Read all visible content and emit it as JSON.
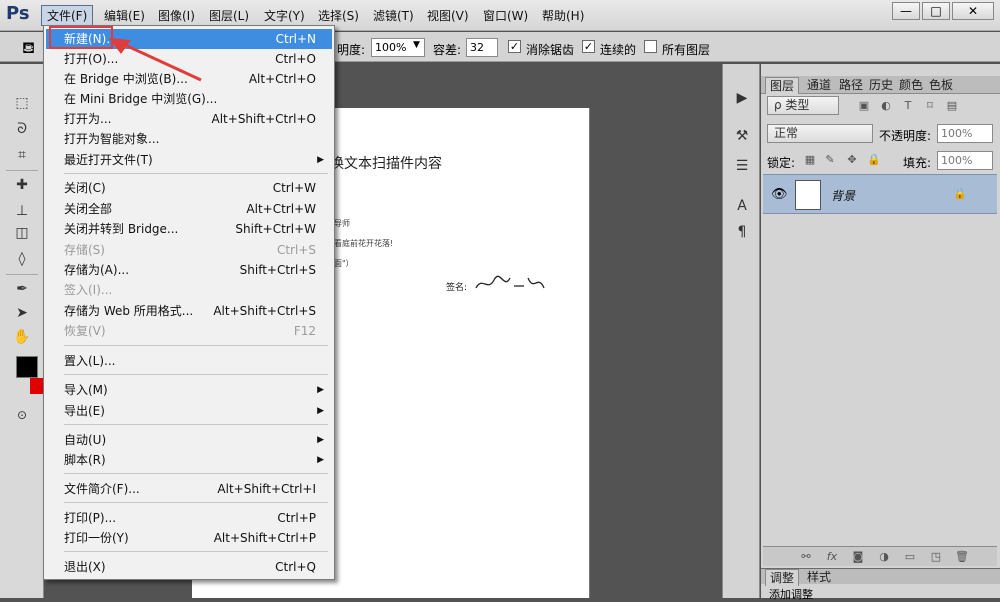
{
  "app": {
    "logo": "Ps",
    "menubar": [
      "文件(F)",
      "编辑(E)",
      "图像(I)",
      "图层(L)",
      "文字(Y)",
      "选择(S)",
      "滤镜(T)",
      "视图(V)",
      "窗口(W)",
      "帮助(H)"
    ],
    "window_controls": [
      "—",
      "□",
      "✕"
    ]
  },
  "options_bar": {
    "opacity_label": "明度:",
    "opacity_value": "100%",
    "tolerance_label": "容差:",
    "tolerance_value": "32",
    "antialias_label": "消除锯齿",
    "contiguous_label": "连续的",
    "all_layers_label": "所有图层",
    "antialias_checked": "✓",
    "contiguous_checked": "✓"
  },
  "file_menu": {
    "items": [
      {
        "label": "新建(N)...",
        "shortcut": "Ctrl+N"
      },
      {
        "label": "打开(O)...",
        "shortcut": "Ctrl+O"
      },
      {
        "label": "在 Bridge 中浏览(B)...",
        "shortcut": "Alt+Ctrl+O"
      },
      {
        "label": "在 Mini Bridge 中浏览(G)...",
        "shortcut": ""
      },
      {
        "label": "打开为...",
        "shortcut": "Alt+Shift+Ctrl+O"
      },
      {
        "label": "打开为智能对象...",
        "shortcut": ""
      },
      {
        "label": "最近打开文件(T)",
        "shortcut": ""
      },
      {
        "label": "关闭(C)",
        "shortcut": "Ctrl+W"
      },
      {
        "label": "关闭全部",
        "shortcut": "Alt+Ctrl+W"
      },
      {
        "label": "关闭并转到 Bridge...",
        "shortcut": "Shift+Ctrl+W"
      },
      {
        "label": "存储(S)",
        "shortcut": "Ctrl+S"
      },
      {
        "label": "存储为(A)...",
        "shortcut": "Shift+Ctrl+S"
      },
      {
        "label": "签入(I)...",
        "shortcut": ""
      },
      {
        "label": "存储为 Web 所用格式...",
        "shortcut": "Alt+Shift+Ctrl+S"
      },
      {
        "label": "恢复(V)",
        "shortcut": "F12"
      },
      {
        "label": "置入(L)...",
        "shortcut": ""
      },
      {
        "label": "导入(M)",
        "shortcut": ""
      },
      {
        "label": "导出(E)",
        "shortcut": ""
      },
      {
        "label": "自动(U)",
        "shortcut": ""
      },
      {
        "label": "脚本(R)",
        "shortcut": ""
      },
      {
        "label": "文件简介(F)...",
        "shortcut": "Alt+Shift+Ctrl+I"
      },
      {
        "label": "打印(P)...",
        "shortcut": "Ctrl+P"
      },
      {
        "label": "打印一份(Y)",
        "shortcut": "Alt+Shift+Ctrl+P"
      },
      {
        "label": "退出(X)",
        "shortcut": "Ctrl+Q"
      }
    ]
  },
  "document": {
    "title": "换文本扫描件内容",
    "line1": "导师",
    "line2": "看庭前花开花落!",
    "line3": "面\"）",
    "sign_label": "签名:"
  },
  "layers_panel": {
    "tabs": [
      "图层",
      "通道",
      "路径",
      "历史",
      "颜色",
      "色板"
    ],
    "filter_label": "ρ 类型",
    "blend_mode": "正常",
    "opacity_label": "不透明度:",
    "opacity_value": "100%",
    "lock_label": "锁定:",
    "fill_label": "填充:",
    "fill_value": "100%",
    "layer_name": "背景"
  },
  "adjustments_panel": {
    "tabs": [
      "调整",
      "样式"
    ],
    "add_label": "添加调整"
  },
  "colors": {
    "highlight": "#3f8de0",
    "annotation": "#e23b3b",
    "foreground": "#000000",
    "background_swatch": "#e00000",
    "layer_selected": "#a9bcd6"
  }
}
